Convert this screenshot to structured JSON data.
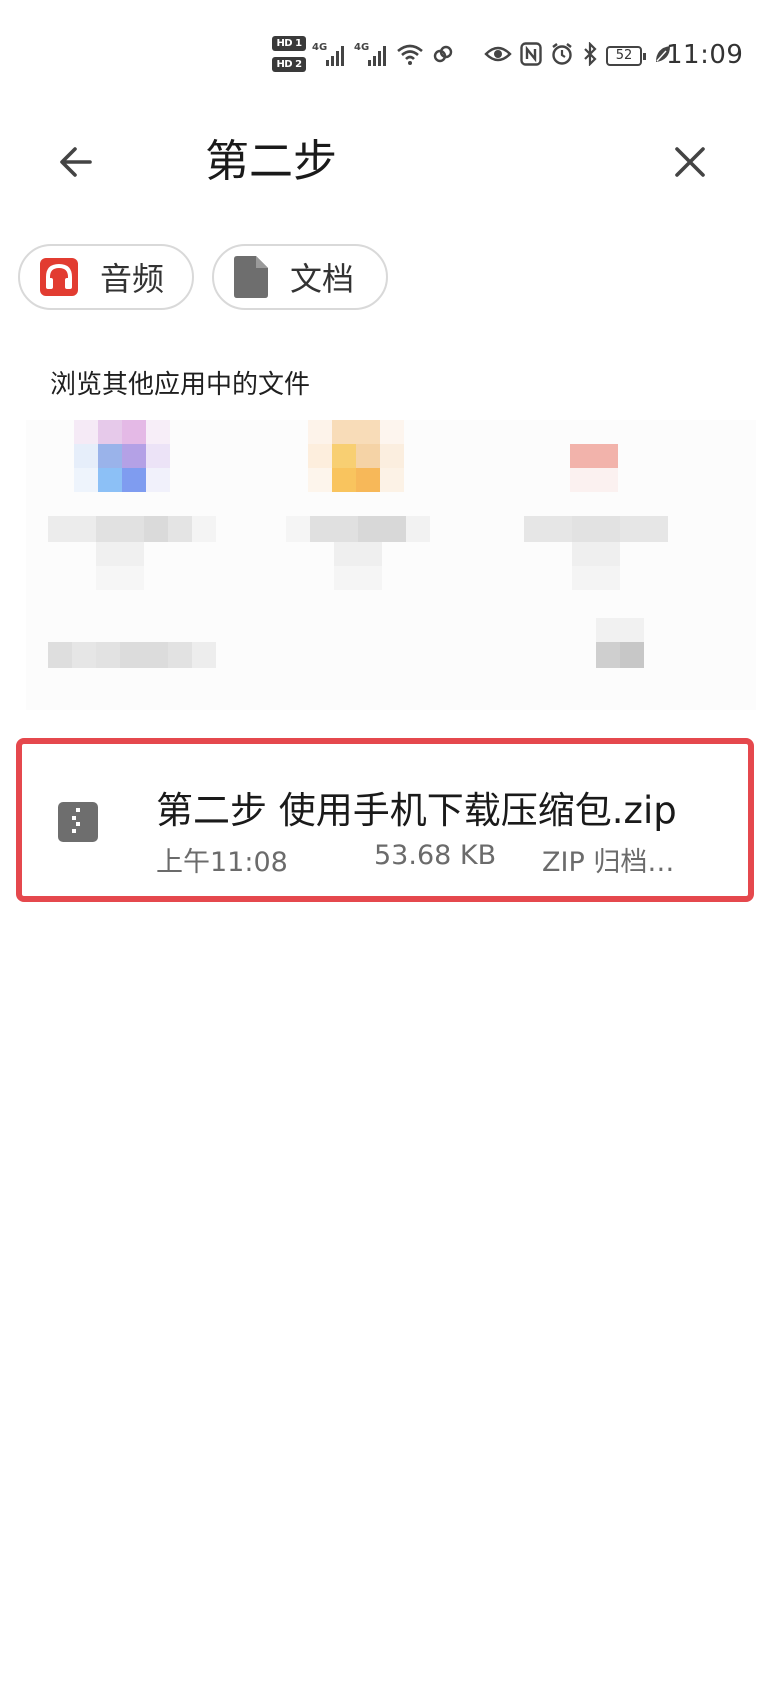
{
  "status_bar": {
    "hd1": "HD 1",
    "hd2": "HD 2",
    "net1": "4G",
    "net2": "4G",
    "battery": "52",
    "time": "11:09",
    "icons": [
      "signal-icon",
      "signal-icon",
      "wifi-icon",
      "link-icon",
      "eye-icon",
      "nfc-icon",
      "alarm-icon",
      "bluetooth-icon",
      "battery-icon",
      "leaf-icon"
    ]
  },
  "app_bar": {
    "title": "第二步",
    "back_icon": "arrow-left-icon",
    "close_icon": "close-icon"
  },
  "filters": [
    {
      "label": "音频",
      "icon": "headphones-icon",
      "color": "#e23c31"
    },
    {
      "label": "文档",
      "icon": "document-icon",
      "color": "#6e6e6e"
    }
  ],
  "section": {
    "title": "浏览其他应用中的文件"
  },
  "files": [
    {
      "name": "第二步 使用手机下载压缩包.zip",
      "time": "上午11:08",
      "size": "53.68 KB",
      "type": "ZIP 归档…",
      "icon": "zip-file-icon"
    }
  ],
  "colors": {
    "highlight_border": "#e5484d",
    "chip_border": "#d9d9d9",
    "audio_icon": "#e23c31"
  }
}
